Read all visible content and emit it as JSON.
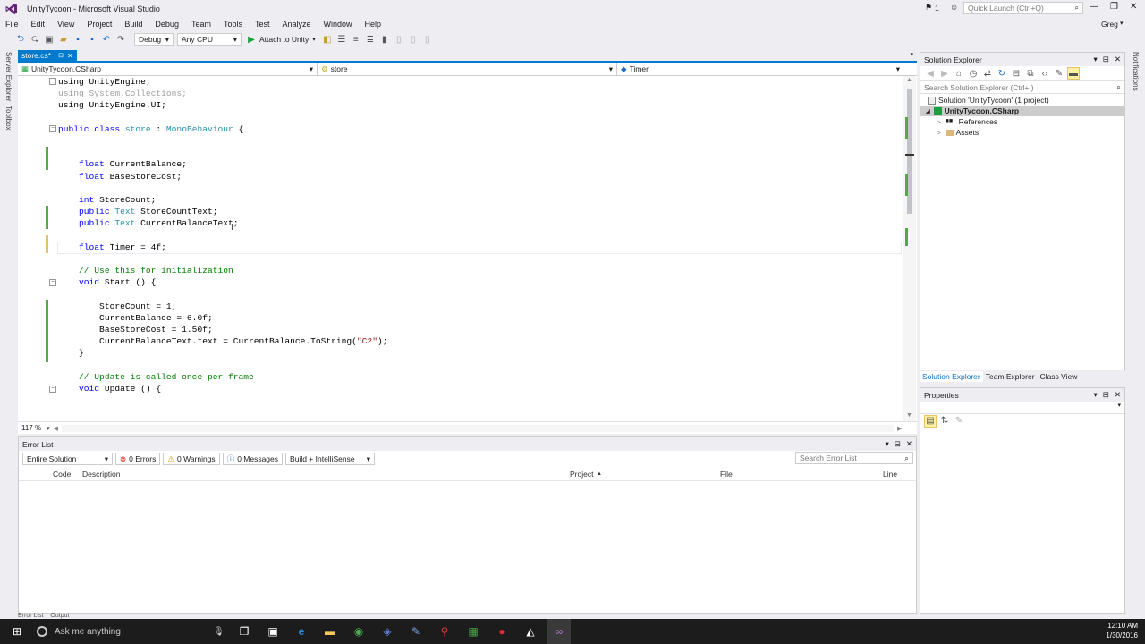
{
  "window": {
    "title": "UnityTycoon - Microsoft Visual Studio",
    "notifications_count": "1",
    "quick_launch_placeholder": "Quick Launch (Ctrl+Q)",
    "user": "Greg"
  },
  "menu": [
    "File",
    "Edit",
    "View",
    "Project",
    "Build",
    "Debug",
    "Team",
    "Tools",
    "Test",
    "Analyze",
    "Window",
    "Help"
  ],
  "toolbar": {
    "config": "Debug",
    "platform": "Any CPU",
    "attach": "Attach to Unity"
  },
  "left_strip": {
    "server_explorer": "Server Explorer",
    "toolbox": "Toolbox"
  },
  "right_strip": {
    "notifications": "Notifications"
  },
  "doc_tab": {
    "label": "store.cs*"
  },
  "nav": {
    "project": "UnityTycoon.CSharp",
    "type": "store",
    "member": "Timer"
  },
  "code_lines": [
    [
      {
        "t": "using UnityEngine;",
        "c": ""
      }
    ],
    [
      {
        "t": "using System.Collections;",
        "c": "gr"
      }
    ],
    [
      {
        "t": "using UnityEngine.UI;",
        "c": ""
      }
    ],
    [
      {
        "t": "",
        "c": ""
      }
    ],
    [
      {
        "t": "public class ",
        "c": "kw"
      },
      {
        "t": "store",
        "c": "ty"
      },
      {
        "t": " : ",
        "c": ""
      },
      {
        "t": "MonoBehaviour",
        "c": "ty"
      },
      {
        "t": " {",
        "c": ""
      }
    ],
    [
      {
        "t": "",
        "c": ""
      }
    ],
    [
      {
        "t": "",
        "c": ""
      }
    ],
    [
      {
        "t": "    float ",
        "c": "kw"
      },
      {
        "t": "CurrentBalance;",
        "c": ""
      }
    ],
    [
      {
        "t": "    float ",
        "c": "kw"
      },
      {
        "t": "BaseStoreCost;",
        "c": ""
      }
    ],
    [
      {
        "t": "",
        "c": ""
      }
    ],
    [
      {
        "t": "    int ",
        "c": "kw"
      },
      {
        "t": "StoreCount;",
        "c": ""
      }
    ],
    [
      {
        "t": "    public ",
        "c": "kw"
      },
      {
        "t": "Text",
        "c": "ty"
      },
      {
        "t": " StoreCountText;",
        "c": ""
      }
    ],
    [
      {
        "t": "    public ",
        "c": "kw"
      },
      {
        "t": "Text",
        "c": "ty"
      },
      {
        "t": " CurrentBalanceText;",
        "c": ""
      }
    ],
    [
      {
        "t": "",
        "c": ""
      }
    ],
    [
      {
        "t": "    float ",
        "c": "kw"
      },
      {
        "t": "Timer = 4f;",
        "c": ""
      }
    ],
    [
      {
        "t": "",
        "c": ""
      }
    ],
    [
      {
        "t": "    // Use this for initialization",
        "c": "cm"
      }
    ],
    [
      {
        "t": "    void ",
        "c": "kw"
      },
      {
        "t": "Start () {",
        "c": ""
      }
    ],
    [
      {
        "t": "",
        "c": ""
      }
    ],
    [
      {
        "t": "        StoreCount = 1;",
        "c": ""
      }
    ],
    [
      {
        "t": "        CurrentBalance = 6.0f;",
        "c": ""
      }
    ],
    [
      {
        "t": "        BaseStoreCost = 1.50f;",
        "c": ""
      }
    ],
    [
      {
        "t": "        CurrentBalanceText.text = CurrentBalance.ToString(",
        "c": ""
      },
      {
        "t": "\"C2\"",
        "c": "st"
      },
      {
        "t": ");",
        "c": ""
      }
    ],
    [
      {
        "t": "    }",
        "c": ""
      }
    ],
    [
      {
        "t": "",
        "c": ""
      }
    ],
    [
      {
        "t": "    // Update is called once per frame",
        "c": "cm"
      }
    ],
    [
      {
        "t": "    void ",
        "c": "kw"
      },
      {
        "t": "Update () {",
        "c": ""
      }
    ]
  ],
  "zoom": "117 %",
  "error_list": {
    "title": "Error List",
    "scope": "Entire Solution",
    "errors": "0 Errors",
    "warnings": "0 Warnings",
    "messages": "0 Messages",
    "build_filter": "Build + IntelliSense",
    "search_placeholder": "Search Error List",
    "columns": {
      "code": "Code",
      "description": "Description",
      "project": "Project",
      "file": "File",
      "line": "Line"
    }
  },
  "bottom_tabs": {
    "error_list": "Error List",
    "output": "Output"
  },
  "solution_explorer": {
    "title": "Solution Explorer",
    "search_placeholder": "Search Solution Explorer (Ctrl+;)",
    "solution": "Solution 'UnityTycoon' (1 project)",
    "project": "UnityTycoon.CSharp",
    "references": "References",
    "assets": "Assets",
    "tabs": [
      "Solution Explorer",
      "Team Explorer",
      "Class View"
    ]
  },
  "properties": {
    "title": "Properties"
  },
  "taskbar": {
    "search": "Ask me anything",
    "time": "12:10 AM",
    "date": "1/30/2016"
  },
  "colors": {
    "accent": "#007acc",
    "vs_purple": "#68217a",
    "change_green": "#57a64a"
  }
}
